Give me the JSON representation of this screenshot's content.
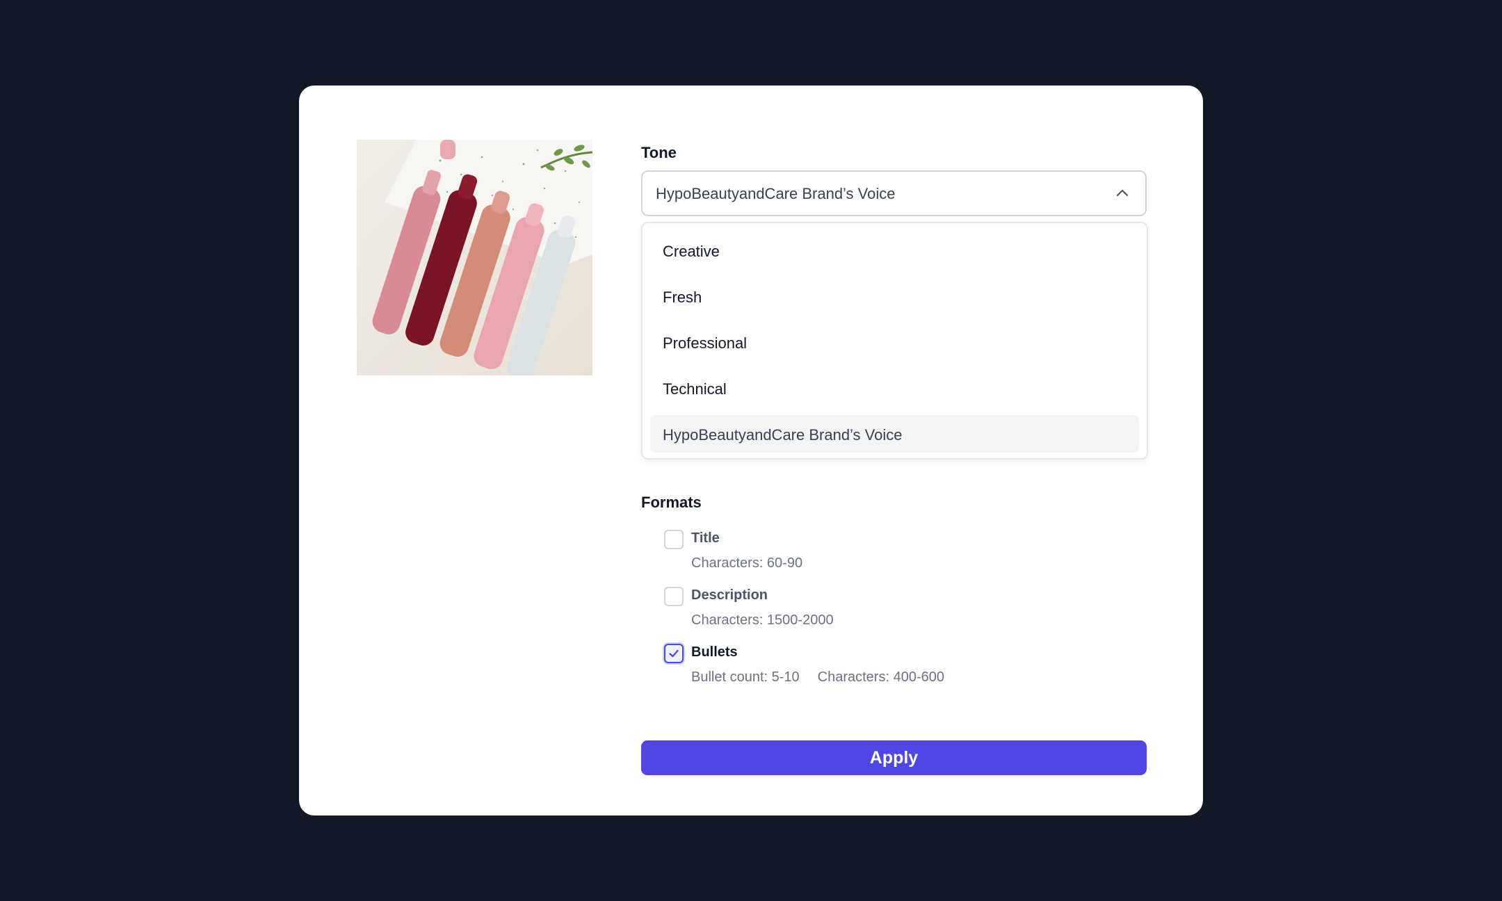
{
  "tone": {
    "label": "Tone",
    "selected_value": "HypoBeautyandCare Brand’s Voice",
    "options": [
      {
        "label": "Creative",
        "selected": false
      },
      {
        "label": "Fresh",
        "selected": false
      },
      {
        "label": "Professional",
        "selected": false
      },
      {
        "label": "Technical",
        "selected": false
      },
      {
        "label": "HypoBeautyandCare Brand’s Voice",
        "selected": true
      }
    ],
    "icon": "chevron-up-icon"
  },
  "formats": {
    "label": "Formats",
    "items": [
      {
        "title": "Title",
        "meta": [
          "Characters: 60-90"
        ],
        "checked": false
      },
      {
        "title": "Description",
        "meta": [
          "Characters: 1500-2000"
        ],
        "checked": false
      },
      {
        "title": "Bullets",
        "meta": [
          "Bullet count: 5-10",
          "Characters: 400-600"
        ],
        "checked": true
      }
    ]
  },
  "apply_button": {
    "label": "Apply"
  },
  "colors": {
    "background": "#111827",
    "card": "#ffffff",
    "accent": "#4f46e5",
    "selected_option_bg": "#f3f4f6"
  }
}
